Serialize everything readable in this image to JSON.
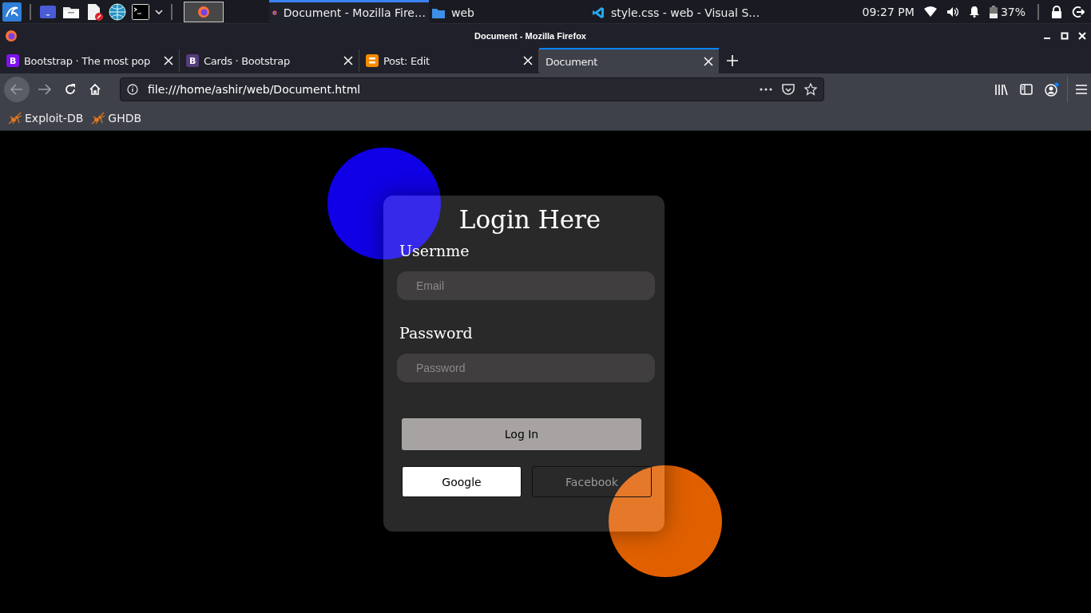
{
  "taskbar": {
    "windows": [
      {
        "title": "Document - Mozilla Fire…",
        "kind": "firefox",
        "selected": true
      },
      {
        "title": "web",
        "kind": "folder",
        "selected": false
      },
      {
        "title": "style.css - web - Visual S…",
        "kind": "vscode",
        "selected": false
      }
    ],
    "clock": "09:27 PM",
    "battery": "37%"
  },
  "window": {
    "title": "Document - Mozilla Firefox"
  },
  "tabs": [
    {
      "label": "Bootstrap · The most pop",
      "kind": "bootstrap",
      "favicon": "B",
      "color": "#7f13ef",
      "selected": false
    },
    {
      "label": "Cards · Bootstrap",
      "kind": "bootstrap",
      "favicon": "B",
      "color": "#563d7c",
      "selected": false
    },
    {
      "label": "Post: Edit",
      "kind": "blogger",
      "color": "#f38b00",
      "selected": false
    },
    {
      "label": "Document",
      "kind": "blank",
      "selected": true
    }
  ],
  "address_bar": {
    "url": "file:///home/ashir/web/Document.html"
  },
  "bookmarks": [
    "Exploit-DB",
    "GHDB"
  ],
  "login": {
    "title": "Login Here",
    "fields": [
      {
        "label": "Usernme",
        "placeholder": "Email"
      },
      {
        "label": "Password",
        "placeholder": "Password"
      }
    ],
    "submit": "Log In",
    "social": [
      {
        "label": "Google",
        "kind": "filled"
      },
      {
        "label": "Facebook",
        "kind": "outline"
      }
    ]
  }
}
